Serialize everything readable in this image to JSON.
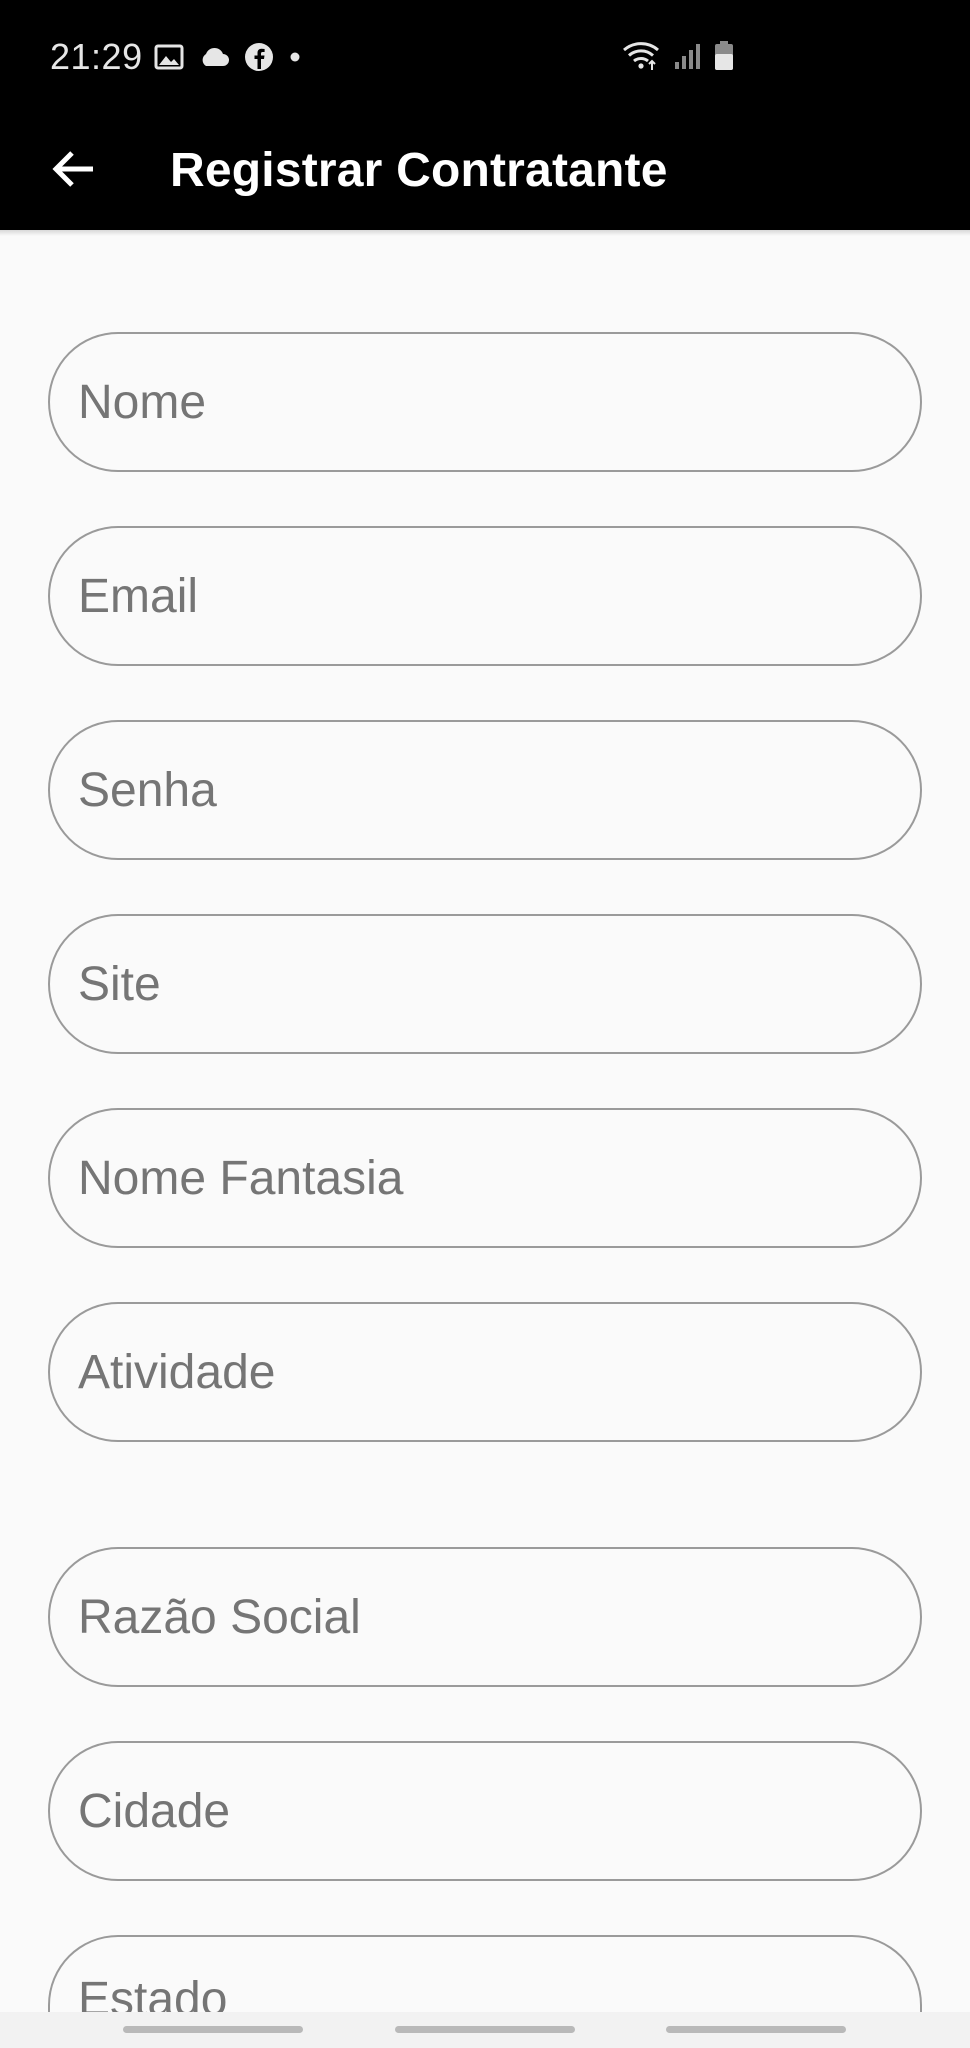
{
  "status_bar": {
    "time": "21:29",
    "left_icons": [
      "image-icon",
      "cloud-icon",
      "facebook-icon",
      "dot-icon"
    ],
    "right_icons": [
      "wifi-icon",
      "signal-icon",
      "battery-icon"
    ]
  },
  "app_bar": {
    "title": "Registrar Contratante",
    "back_icon": "arrow-left-icon"
  },
  "form": {
    "fields": [
      {
        "placeholder": "Nome"
      },
      {
        "placeholder": "Email"
      },
      {
        "placeholder": "Senha"
      },
      {
        "placeholder": "Site"
      },
      {
        "placeholder": "Nome Fantasia"
      },
      {
        "placeholder": "Atividade"
      },
      {
        "placeholder": "Razão Social"
      },
      {
        "placeholder": "Cidade"
      },
      {
        "placeholder": "Estado"
      }
    ]
  },
  "colors": {
    "app_bar_bg": "#000000",
    "page_bg": "#fafafa",
    "field_border": "#9a9a9a",
    "placeholder_text": "#757575"
  }
}
